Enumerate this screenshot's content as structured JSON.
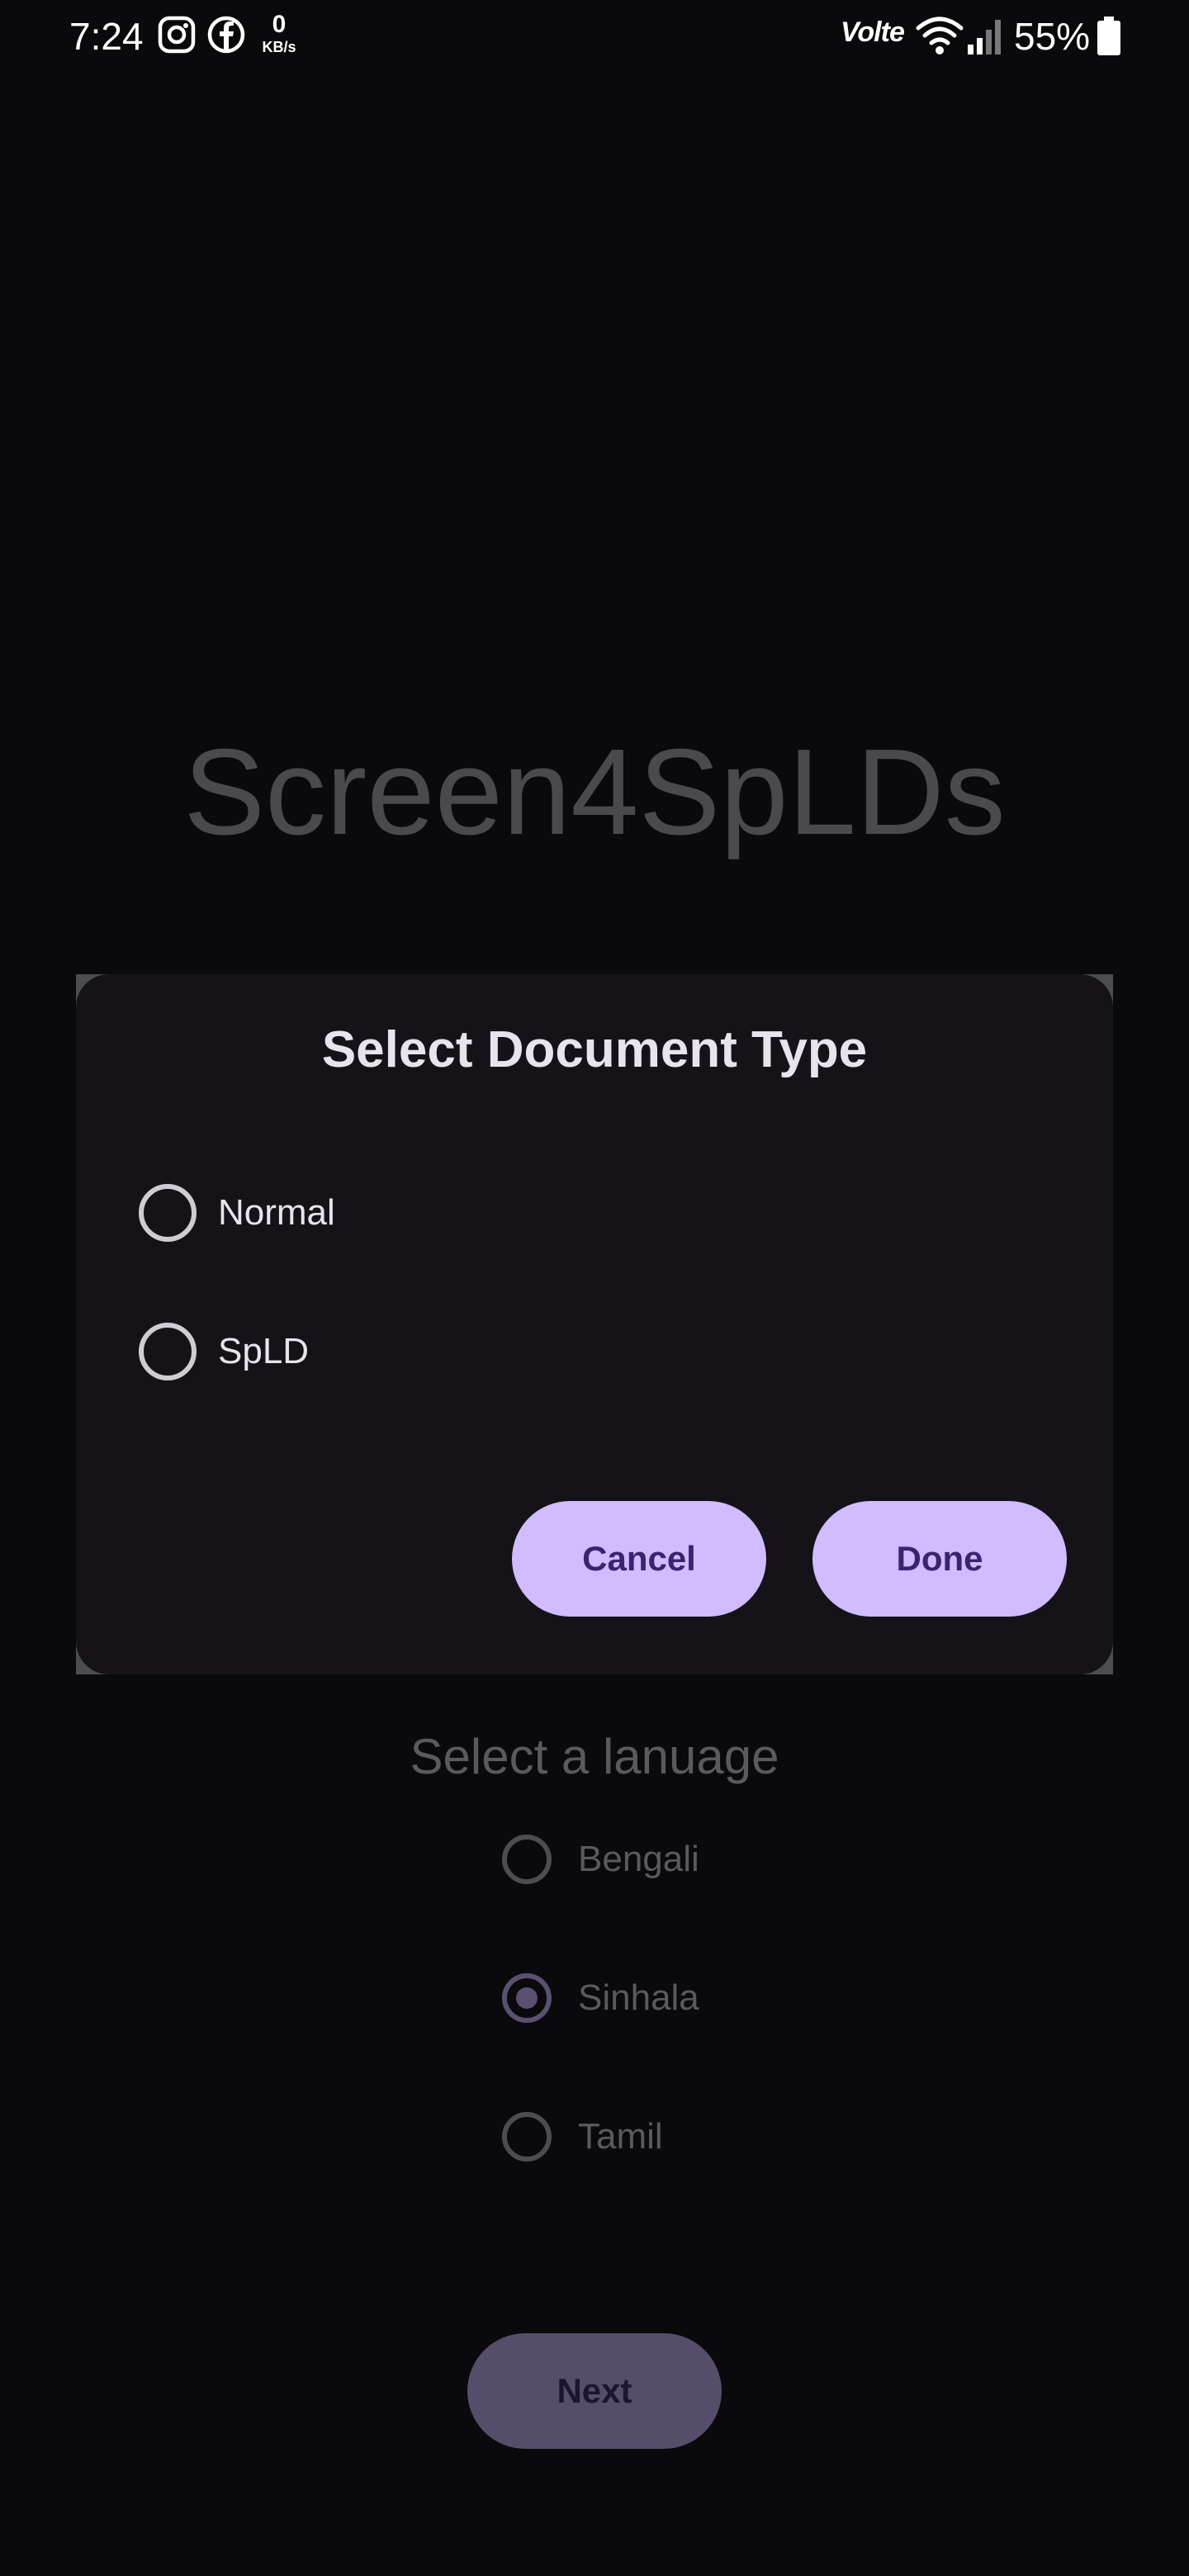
{
  "status_bar": {
    "time": "7:24",
    "net_speed_value": "0",
    "net_speed_unit": "KB/s",
    "volte": "Volte",
    "battery_percent": "55%",
    "icons": [
      "instagram-icon",
      "facebook-icon",
      "wifi-icon",
      "signal-icon",
      "battery-icon"
    ]
  },
  "app": {
    "title": "Screen4SpLDs",
    "language_heading": "Select a lanuage",
    "languages": [
      {
        "label": "Bengali",
        "selected": false
      },
      {
        "label": "Sinhala",
        "selected": true
      },
      {
        "label": "Tamil",
        "selected": false
      }
    ],
    "next_label": "Next"
  },
  "dialog": {
    "title": "Select Document Type",
    "options": [
      {
        "label": "Normal",
        "selected": false
      },
      {
        "label": "SpLD",
        "selected": false
      }
    ],
    "cancel_label": "Cancel",
    "done_label": "Done"
  },
  "colors": {
    "background": "#0a090c",
    "dialog_surface": "#151318",
    "accent": "#d0bcff",
    "accent_text": "#3a2470"
  }
}
